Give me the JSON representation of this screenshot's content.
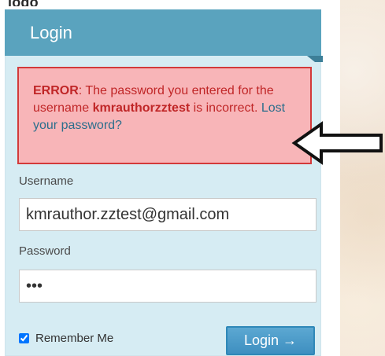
{
  "top_fragment": "logo",
  "widget": {
    "title": "Login"
  },
  "error": {
    "label": "ERROR",
    "before_username": ": The password you entered for the username ",
    "username": "kmrauthorzztest",
    "after_username": " is incorrect. ",
    "lost_password_link": "Lost your password?"
  },
  "form": {
    "username_label": "Username",
    "username_value": "kmrauthor.zztest@gmail.com",
    "password_label": "Password",
    "password_value": "•••",
    "remember_label": "Remember Me",
    "remember_checked": true,
    "login_button": "Login →"
  },
  "colors": {
    "header": "#5aa3be",
    "widget_bg": "#d6ecf3",
    "error_bg": "#f8b5b8",
    "error_border": "#d33a3a",
    "error_text": "#c02627",
    "link": "#2b6e8c",
    "button": "#3e8fc0"
  },
  "icons": {
    "annotation_arrow": "left-arrow-outline-icon"
  }
}
